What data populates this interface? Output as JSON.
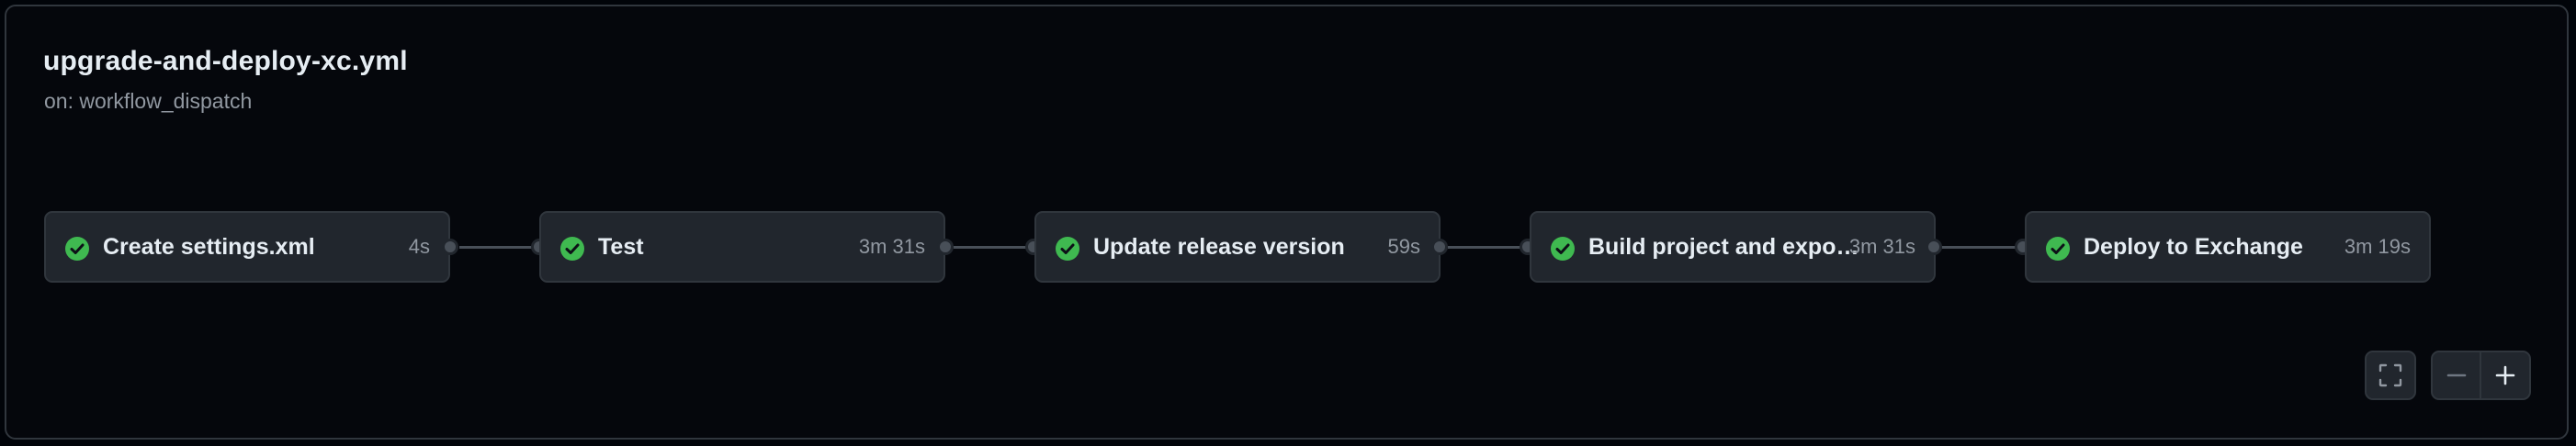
{
  "workflow": {
    "title": "upgrade-and-deploy-xc.yml",
    "trigger": "on: workflow_dispatch"
  },
  "jobs": [
    {
      "name": "Create settings.xml",
      "duration": "4s",
      "status": "success"
    },
    {
      "name": "Test",
      "duration": "3m 31s",
      "status": "success"
    },
    {
      "name": "Update release version",
      "duration": "59s",
      "status": "success"
    },
    {
      "name": "Build project and expo…",
      "duration": "3m 31s",
      "status": "success"
    },
    {
      "name": "Deploy to Exchange",
      "duration": "3m 19s",
      "status": "success"
    }
  ],
  "controls": {
    "fullscreen_icon": "fullscreen-icon",
    "zoom_out_icon": "minus-icon",
    "zoom_in_icon": "plus-icon"
  },
  "colors": {
    "success": "#3fb950",
    "background": "#010409",
    "card": "#21262d",
    "border": "#30363d"
  }
}
